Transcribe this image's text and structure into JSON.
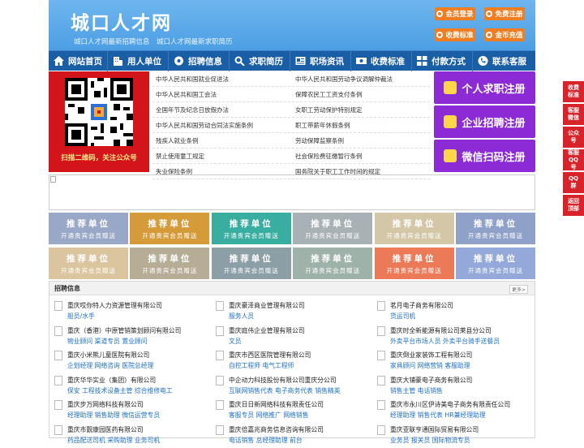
{
  "header": {
    "title": "城口人才网",
    "subtitle": "城口人才网最新招聘信息　城口人才网最新求职简历",
    "buttons": [
      {
        "label": "会员登录"
      },
      {
        "label": "免费注册"
      },
      {
        "label": "收费标准"
      },
      {
        "label": "金币充值"
      }
    ]
  },
  "nav": [
    {
      "label": "网站首页",
      "icon": "home-icon"
    },
    {
      "label": "用人单位",
      "icon": "building-icon"
    },
    {
      "label": "招聘信息",
      "icon": "broadcast-icon"
    },
    {
      "label": "求职简历",
      "icon": "search-icon"
    },
    {
      "label": "职场资讯",
      "icon": "news-icon"
    },
    {
      "label": "收费标准",
      "icon": "cash-icon"
    },
    {
      "label": "付款方式",
      "icon": "grid-icon"
    },
    {
      "label": "联系客服",
      "icon": "phone-icon"
    }
  ],
  "qr": {
    "caption": "扫描二维码，关注公众号"
  },
  "links": {
    "left": [
      "中华人民共和国就业促进法",
      "中华人民共和国工会法",
      "全国年节及纪念日放假办法",
      "中华人民共和国劳动合同法实施条例",
      "残疾人就业条例",
      "禁止使用童工规定",
      "失业保险条例"
    ],
    "right": [
      "中华人民共和国劳动争议调解仲裁法",
      "保障农民工工资支付条例",
      "女职工劳动保护特别规定",
      "职工带薪年休假条例",
      "劳动保障监察条例",
      "社会保险费征缴暂行条例",
      "国务院关于职工工作时间的规定"
    ]
  },
  "register": [
    {
      "label": "个人求职注册"
    },
    {
      "label": "企业招聘注册"
    },
    {
      "label": "微信扫码注册"
    }
  ],
  "recommend": {
    "title": "推荐单位",
    "sub": "开通贵宾会员赠送",
    "colors": [
      "#9aa8c7",
      "#d59b39",
      "#39aea0",
      "#a8b1b6",
      "#d4c7a8",
      "#8fa1c9",
      "#dac59f",
      "#b7ad97",
      "#8c9fa6",
      "#9fb2aa",
      "#ec7a59",
      "#94a9d9"
    ]
  },
  "jobs": {
    "title": "招聘信息",
    "more": "更多>",
    "columns": [
      [
        {
          "company": "重庆哎你特人力资源管理有限公司",
          "jobs": "船员/水手"
        },
        {
          "company": "重庆（香港）中原管销策划顾问有限公司",
          "jobs": "物业顾问 渠道专员 置业顾问"
        },
        {
          "company": "重庆小米熊儿童医院有限公司",
          "jobs": "企划经理 网络咨询 医院总经理"
        },
        {
          "company": "重庆华华实业（集团）有限公司",
          "jobs": "保安 工程技术设备主管 综合维修电工"
        },
        {
          "company": "重庆步万网络科技有限公司",
          "jobs": "经理助理 销售助理 微信运营专员"
        },
        {
          "company": "重庆市觐康园医药有限公司",
          "jobs": "药品配送司机 采购助理 业务司机"
        }
      ],
      [
        {
          "company": "重庆豪泽商业管理有限公司",
          "jobs": "服务人员"
        },
        {
          "company": "重庆庭伟企业管理有限公司",
          "jobs": "文员"
        },
        {
          "company": "重庆市西区医院管理有限公司",
          "jobs": "自控工程师 电气工程师"
        },
        {
          "company": "中企动力科技股份有限公司重庆分公司",
          "jobs": "互联网销售代表 电子商务代表 销售精英"
        },
        {
          "company": "重庆日日新网络科技有限责任公司",
          "jobs": "客服专员 网络推广 网络销售"
        },
        {
          "company": "重庆倍嘉兆商务信息咨询有限公司",
          "jobs": "电话销售 总经理助理 前台"
        }
      ],
      [
        {
          "company": "茗月电子商务有限公司",
          "jobs": "货运司机"
        },
        {
          "company": "重庆时全新能源有限公司莱县分公司",
          "jobs": "外卖平台市场人员 外卖平台骑手送餐员"
        },
        {
          "company": "重庆倒业家装饰工程有限公司",
          "jobs": "家具顾问 网络营销 客服助理"
        },
        {
          "company": "重庆大铺豪电子商务有限公司",
          "jobs": "销售主管 电话销售"
        },
        {
          "company": "重庆市永川区伊诗美电子商务有限责任公司",
          "jobs": "经理助理 销售代表 HR兼经理助理"
        },
        {
          "company": "重庆亚联亨通国际贸易有限公司",
          "jobs": "业务员 报关员 国际物流专员"
        }
      ]
    ]
  },
  "side": [
    {
      "label": "收费标准"
    },
    {
      "label": "客服微信"
    },
    {
      "label": "公众号"
    },
    {
      "label": "客服QQ号"
    },
    {
      "label": "QQ群"
    },
    {
      "label": "返回顶部"
    }
  ]
}
